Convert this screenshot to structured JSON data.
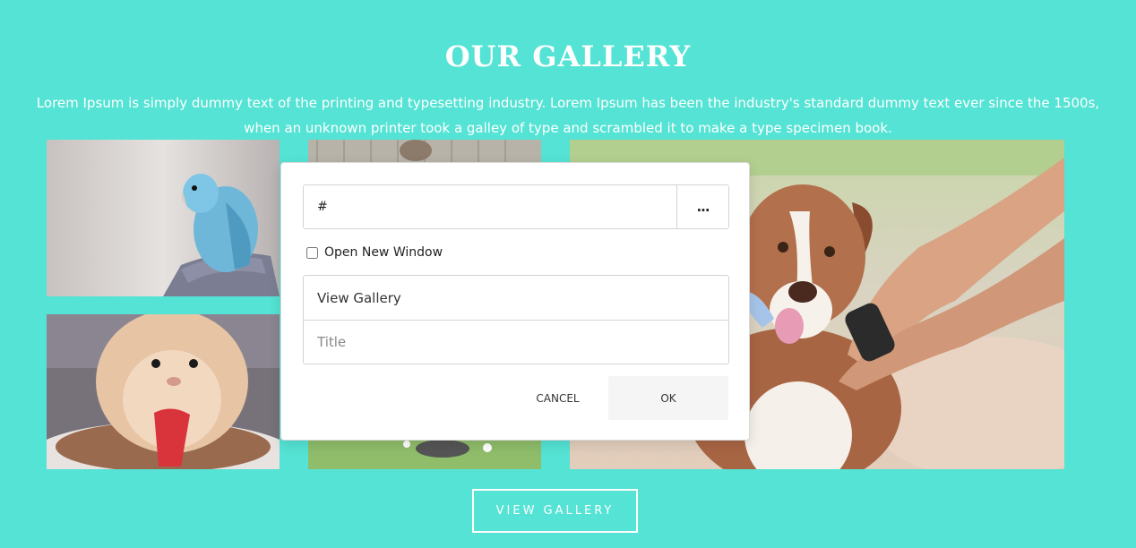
{
  "header": {
    "title": "OUR GALLERY",
    "description": "Lorem Ipsum is simply dummy text of the printing and typesetting industry. Lorem Ipsum has been the industry's standard dummy text ever since the 1500s, when an unknown printer took a galley of type and scrambled it to make a type specimen book."
  },
  "gallery": {
    "images": [
      {
        "subject": "blue parrot"
      },
      {
        "subject": "hamster eating strawberry"
      },
      {
        "subject": "animal in grass"
      },
      {
        "subject": "dog drinking from hands"
      }
    ],
    "button_label": "VIEW GALLERY"
  },
  "link_dialog": {
    "url_value": "#",
    "browse_label": "...",
    "new_window_label": "Open New Window",
    "new_window_checked": false,
    "text_value": "View Gallery",
    "title_placeholder": "Title",
    "cancel_label": "CANCEL",
    "ok_label": "OK"
  },
  "colors": {
    "background": "#54e3d4",
    "text": "#ffffff",
    "dialog_bg": "#ffffff",
    "ok_bg": "#f5f5f5"
  }
}
